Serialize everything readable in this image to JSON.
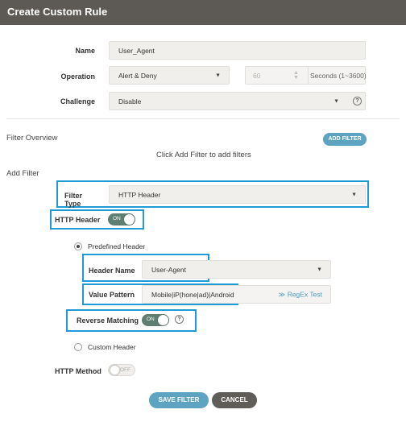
{
  "header": {
    "title": "Create Custom Rule"
  },
  "form": {
    "name_label": "Name",
    "name_value": "User_Agent",
    "operation_label": "Operation",
    "operation_value": "Alert & Deny",
    "seconds_value": "60",
    "seconds_suffix": "Seconds (1~3600)",
    "challenge_label": "Challenge",
    "challenge_value": "Disable"
  },
  "filter_overview": {
    "title": "Filter Overview",
    "add_filter_button": "ADD FILTER",
    "empty_hint": "Click Add Filter to add filters"
  },
  "add_filter": {
    "title": "Add Filter",
    "filter_type_label": "Filter Type",
    "filter_type_value": "HTTP Header",
    "http_header_label": "HTTP Header",
    "http_header_toggle": "ON",
    "predefined_header_label": "Predefined Header",
    "header_name_label": "Header Name",
    "header_name_value": "User-Agent",
    "value_pattern_label": "Value Pattern",
    "value_pattern_value": "Mobile|iP(hone|ad)|Android",
    "regex_test_link": "RegEx Test",
    "reverse_matching_label": "Reverse Matching",
    "reverse_matching_toggle": "ON",
    "custom_header_label": "Custom Header",
    "http_method_label": "HTTP Method",
    "http_method_toggle": "OFF"
  },
  "actions": {
    "save": "SAVE FILTER",
    "cancel": "CANCEL"
  },
  "icons": {
    "dropdown": "caret-down-icon",
    "spinner": "spinner-arrows-icon",
    "help": "question-circle-icon",
    "regex": "chevron-double-down-icon"
  },
  "colors": {
    "titlebar": "#5d5a55",
    "accent": "#5da3c2",
    "highlight": "#1e9ad6",
    "toggle_on": "#5e7e72",
    "cancel": "#605c57"
  }
}
